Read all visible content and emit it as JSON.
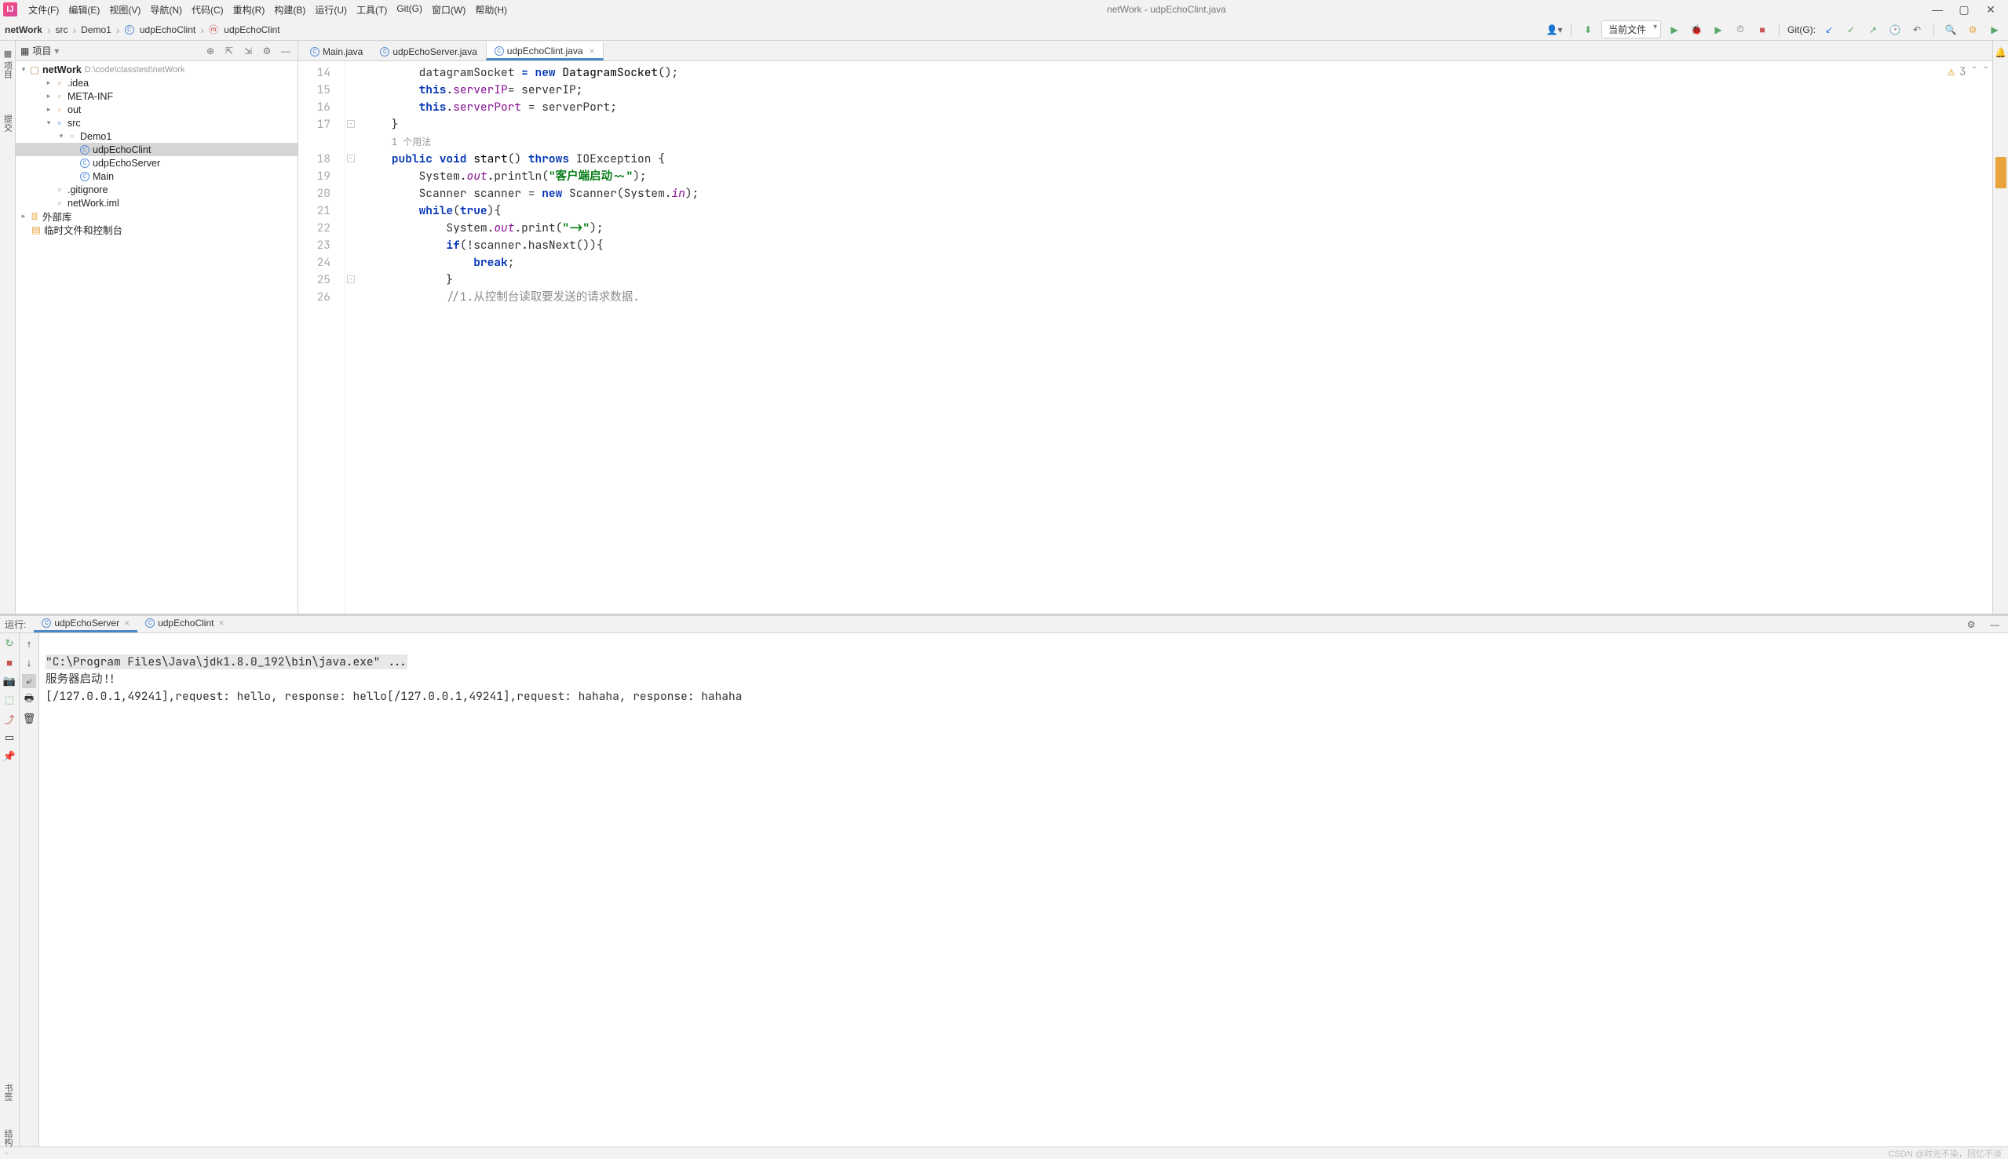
{
  "menubar": {
    "items": [
      "文件(F)",
      "编辑(E)",
      "视图(V)",
      "导航(N)",
      "代码(C)",
      "重构(R)",
      "构建(B)",
      "运行(U)",
      "工具(T)",
      "Git(G)",
      "窗口(W)",
      "帮助(H)"
    ],
    "title": "netWork - udpEchoClint.java"
  },
  "breadcrumb": {
    "root": "netWork",
    "items": [
      "src",
      "Demo1",
      "udpEchoClint",
      "udpEchoClint"
    ]
  },
  "toolbar": {
    "config_label": "当前文件",
    "git_label": "Git(G):"
  },
  "project": {
    "panel_title": "项目",
    "root": {
      "name": "netWork",
      "path": "D:\\code\\classtest\\netWork"
    },
    "tree": [
      {
        "name": ".idea",
        "type": "folder",
        "indent": 2
      },
      {
        "name": "META-INF",
        "type": "folder",
        "indent": 2
      },
      {
        "name": "out",
        "type": "folder-open",
        "indent": 2
      },
      {
        "name": "src",
        "type": "folder-src",
        "indent": 2,
        "expanded": true
      },
      {
        "name": "Demo1",
        "type": "folder",
        "indent": 3,
        "expanded": true
      },
      {
        "name": "udpEchoClint",
        "type": "java",
        "indent": 4,
        "selected": true
      },
      {
        "name": "udpEchoServer",
        "type": "java",
        "indent": 4
      },
      {
        "name": "Main",
        "type": "java",
        "indent": 4
      },
      {
        "name": ".gitignore",
        "type": "file",
        "indent": 2
      },
      {
        "name": "netWork.iml",
        "type": "file",
        "indent": 2
      }
    ],
    "ext_lib": "外部库",
    "scratch": "临时文件和控制台"
  },
  "tabs": [
    {
      "label": "Main.java",
      "icon": "java",
      "active": false
    },
    {
      "label": "udpEchoServer.java",
      "icon": "java",
      "active": false
    },
    {
      "label": "udpEchoClint.java",
      "icon": "java",
      "active": true
    }
  ],
  "editor": {
    "warnings": "3",
    "usage_hint": "1 个用法",
    "lines": [
      {
        "n": 14,
        "html": "        datagramSocket <span class='kw'>= new</span> <span class='type'>DatagramSocket</span>();"
      },
      {
        "n": 15,
        "html": "        <span class='kw'>this</span>.<span class='field'>serverIP</span>= serverIP;"
      },
      {
        "n": 16,
        "html": "        <span class='kw'>this</span>.<span class='field'>serverPort</span> = serverPort;"
      },
      {
        "n": 17,
        "html": "    }"
      },
      {
        "n": "",
        "html": "    <span class='usage-hint'>1 个用法</span>"
      },
      {
        "n": 18,
        "html": "    <span class='kw'>public void</span> <span class='method'>start</span>() <span class='kw'>throws</span> IOException {"
      },
      {
        "n": 19,
        "html": "        System.<span class='static'>out</span>.println(<span class='str'>\"客户端启动~~\"</span>);"
      },
      {
        "n": 20,
        "html": "        Scanner scanner = <span class='kw'>new</span> Scanner(System.<span class='static'>in</span>);"
      },
      {
        "n": 21,
        "html": "        <span class='kw'>while</span>(<span class='kw'>true</span>){"
      },
      {
        "n": 22,
        "html": "            System.<span class='static'>out</span>.print(<span class='str'>\"->\"</span>);"
      },
      {
        "n": 23,
        "html": "            <span class='kw'>if</span>(!scanner.hasNext()){"
      },
      {
        "n": 24,
        "html": "                <span class='kw'>break</span>;"
      },
      {
        "n": 25,
        "html": "            }"
      },
      {
        "n": 26,
        "html": "            <span class='comment'>//1.从控制台读取要发送的请求数据.</span>"
      }
    ]
  },
  "run": {
    "label": "运行:",
    "tabs": [
      {
        "label": "udpEchoServer",
        "active": true
      },
      {
        "label": "udpEchoClint",
        "active": false
      }
    ],
    "cmd": "\"C:\\Program Files\\Java\\jdk1.8.0_192\\bin\\java.exe\" ...",
    "out1": "服务器启动!!",
    "out2": "[/127.0.0.1,49241],request: hello, response: hello[/127.0.0.1,49241],request: hahaha, response: hahaha"
  },
  "sidebars": {
    "left_top": "项目",
    "left_mid": "提交",
    "left_bottom1": "书签",
    "left_bottom2": "结构",
    "right_top": "通知"
  },
  "statusbar": {
    "watermark": "CSDN @时光不染，回忆不淡"
  }
}
